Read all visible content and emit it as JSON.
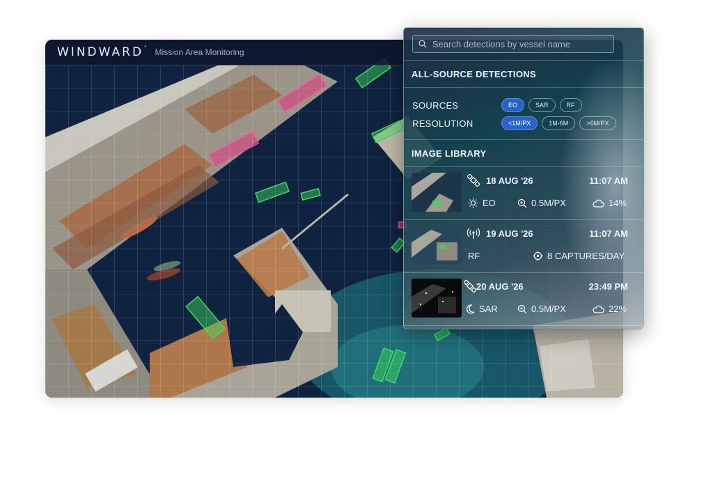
{
  "map": {
    "brand": "WINDWARD",
    "brand_mark": "°",
    "subtitle": "Mission Area Monitoring"
  },
  "panel": {
    "search_placeholder": "Search detections by vessel name",
    "detections_title": "ALL-SOURCE DETECTIONS",
    "sources_label": "SOURCES",
    "sources": [
      {
        "label": "EO",
        "selected": true
      },
      {
        "label": "SAR",
        "selected": false
      },
      {
        "label": "RF",
        "selected": false
      }
    ],
    "resolution_label": "RESOLUTION",
    "resolutions": [
      {
        "label": "<1M/PX",
        "selected": true
      },
      {
        "label": "1M-6M",
        "selected": false
      },
      {
        "label": ">6M/PX",
        "selected": false
      }
    ],
    "library_title": "IMAGE LIBRARY",
    "library": [
      {
        "source_icon": "satellite-icon",
        "date": "18 AUG '26",
        "time": "11:07 AM",
        "type_icon": "sun-icon",
        "type": "EO",
        "res_icon": "zoom-icon",
        "resolution": "0.5M/PX",
        "cloud_icon": "cloud-icon",
        "cloud": "14%"
      },
      {
        "source_icon": "antenna-icon",
        "date": "19 AUG '26",
        "time": "11:07 AM",
        "type": "RF",
        "captures_icon": "target-icon",
        "captures": "8 CAPTURES/DAY"
      },
      {
        "source_icon": "satellite-icon",
        "date": "20 AUG '26",
        "time": "23:49 PM",
        "type_icon": "moon-icon",
        "type": "SAR",
        "res_icon": "zoom-icon",
        "resolution": "0.5M/PX",
        "cloud_icon": "cloud-icon",
        "cloud": "22%"
      }
    ]
  },
  "colors": {
    "accent": "#2a63c7",
    "detection_green": "#3ddc5a",
    "detection_pink": "#e0377f",
    "water": "#0f2340"
  }
}
